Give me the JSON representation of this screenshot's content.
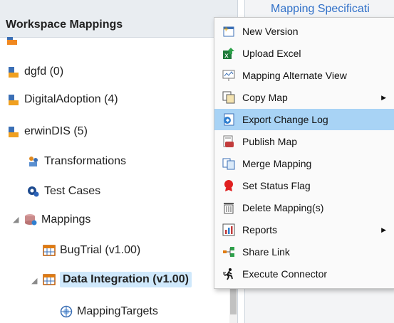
{
  "tree_panel": {
    "title": "Workspace Mappings",
    "items": [
      {
        "label": "dgfd (0)"
      },
      {
        "label": "DigitalAdoption (4)"
      },
      {
        "label": "erwinDIS (5)"
      },
      {
        "label": "Transformations"
      },
      {
        "label": "Test Cases"
      },
      {
        "label": "Mappings"
      },
      {
        "label": "BugTrial (v1.00)"
      },
      {
        "label": "Data Integration (v1.00)"
      },
      {
        "label": "MappingTargets"
      }
    ]
  },
  "right_panel": {
    "tab_label": "Mapping Specificati"
  },
  "context_menu": {
    "items": [
      {
        "label": "New Version",
        "icon": "new-version-icon"
      },
      {
        "label": "Upload Excel",
        "icon": "upload-excel-icon"
      },
      {
        "label": "Mapping Alternate View",
        "icon": "alternate-view-icon"
      },
      {
        "label": "Copy Map",
        "icon": "copy-map-icon",
        "submenu": true
      },
      {
        "label": "Export Change Log",
        "icon": "export-change-log-icon",
        "highlighted": true
      },
      {
        "label": "Publish Map",
        "icon": "publish-map-icon"
      },
      {
        "label": "Merge Mapping",
        "icon": "merge-mapping-icon"
      },
      {
        "label": "Set Status Flag",
        "icon": "status-flag-icon"
      },
      {
        "label": "Delete Mapping(s)",
        "icon": "trash-icon"
      },
      {
        "label": "Reports",
        "icon": "reports-icon",
        "submenu": true
      },
      {
        "label": "Share Link",
        "icon": "share-link-icon"
      },
      {
        "label": "Execute Connector",
        "icon": "execute-connector-icon"
      }
    ],
    "highlight_color": "#a8d3f5"
  }
}
